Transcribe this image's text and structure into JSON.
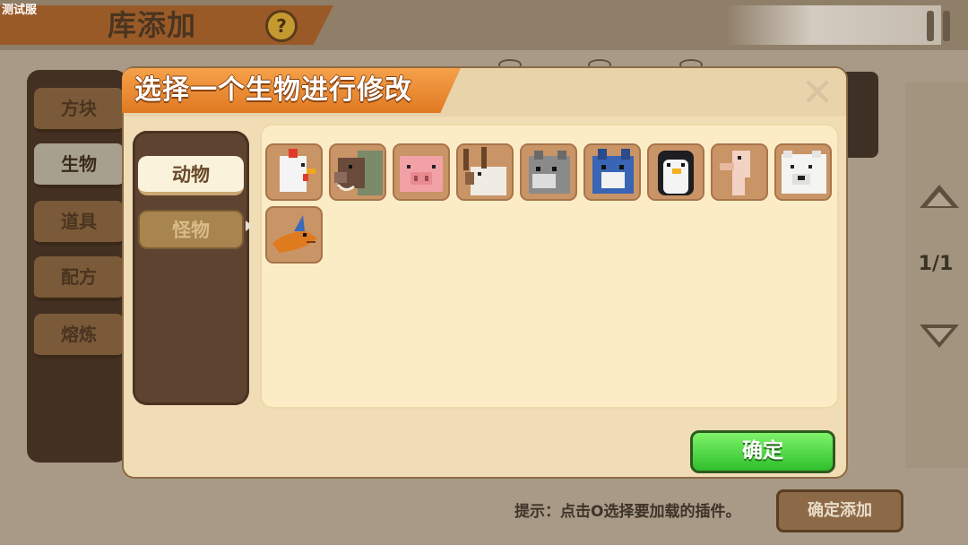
{
  "watermark": "测试服",
  "background": {
    "title": "库添加",
    "help_symbol": "?",
    "side_tabs": [
      "方块",
      "生物",
      "道具",
      "配方",
      "熔炼"
    ],
    "page_indicator": "1/1",
    "tip": "提示：点击O选择要加载的插件。",
    "confirm_add_label": "确定添加"
  },
  "modal": {
    "title": "选择一个生物进行修改",
    "close_symbol": "✕",
    "categories": [
      {
        "label": "动物",
        "selected": true
      },
      {
        "label": "怪物",
        "selected": false
      }
    ],
    "creatures": [
      {
        "icon": "chicken-icon"
      },
      {
        "icon": "boar-icon"
      },
      {
        "icon": "pig-icon"
      },
      {
        "icon": "moose-icon"
      },
      {
        "icon": "wolf-icon"
      },
      {
        "icon": "blue-wolf-icon"
      },
      {
        "icon": "penguin-icon"
      },
      {
        "icon": "ostrich-icon"
      },
      {
        "icon": "polar-bear-icon"
      },
      {
        "icon": "raptor-icon"
      }
    ],
    "confirm_label": "确定"
  },
  "colors": {
    "accent_orange": "#e07a22",
    "confirm_green": "#2fbf2c",
    "panel_brown": "#5e4430"
  }
}
